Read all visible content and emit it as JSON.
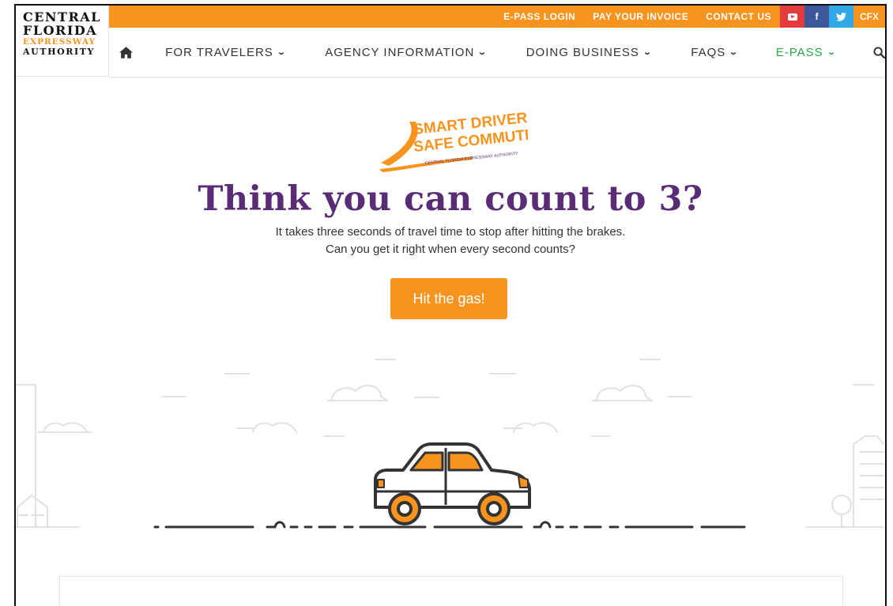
{
  "logo": {
    "line1": "CENTRAL",
    "line2": "FLORIDA",
    "line3": "EXPRESSWAY",
    "line4": "AUTHORITY"
  },
  "topbar": {
    "links": [
      "E-PASS LOGIN",
      "PAY YOUR INVOICE",
      "CONTACT US"
    ],
    "social": {
      "facebook": "f",
      "cfx": "CFX"
    },
    "accent": "#f7931e"
  },
  "nav": {
    "items": [
      "FOR TRAVELERS",
      "AGENCY INFORMATION",
      "DOING BUSINESS",
      "FAQS",
      "E-PASS"
    ],
    "active_color": "#2aa84a"
  },
  "hero": {
    "badge_line1": "SMART DRIVERS.",
    "badge_line2": "SAFE COMMUTE.",
    "badge_line3": "CENTRAL FLORIDA EXPRESSWAY AUTHORITY",
    "headline": "Think you can count to 3?",
    "sub1": "It takes three seconds of travel time to stop after hitting the brakes.",
    "sub2": "Can you get it right when every second counts?",
    "cta": "Hit the gas!",
    "headline_color": "#5b2c76"
  }
}
